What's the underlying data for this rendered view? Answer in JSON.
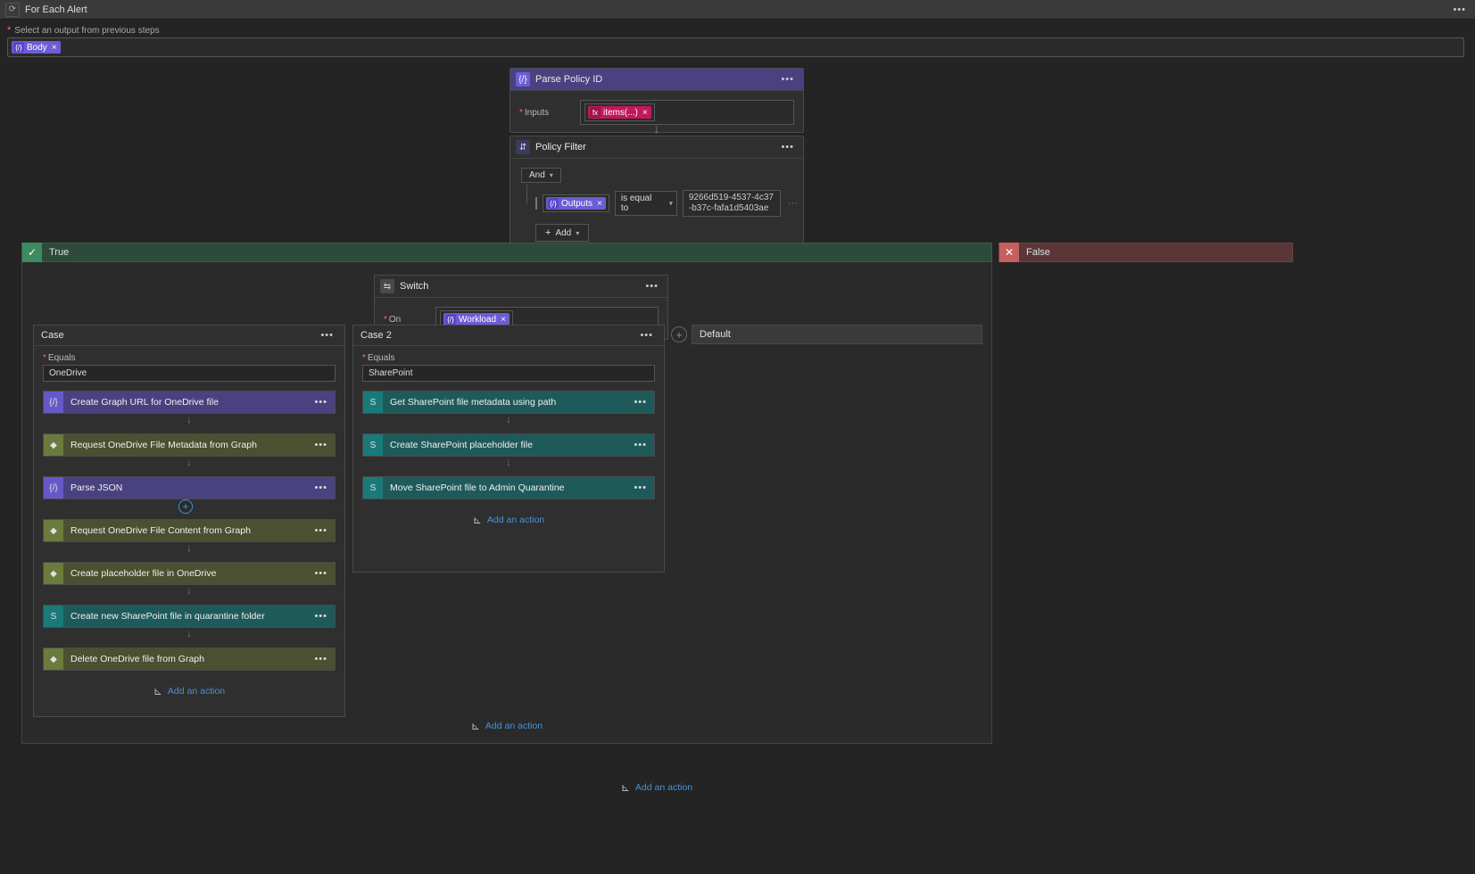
{
  "topbar": {
    "title": "For Each Alert"
  },
  "output_hint": "Select an output from previous steps",
  "body_token": "Body",
  "parse_policy": {
    "title": "Parse Policy ID",
    "inputs_label": "Inputs",
    "token": "items(...)"
  },
  "policy_filter": {
    "title": "Policy Filter",
    "and": "And",
    "output_token": "Outputs",
    "op": "is equal to",
    "value": "9266d519-4537-4c37-b37c-fafa1d5403ae",
    "add": "Add"
  },
  "branches": {
    "true": "True",
    "false": "False"
  },
  "switch": {
    "title": "Switch",
    "on_label": "On",
    "workload_token": "Workload"
  },
  "case1": {
    "title": "Case",
    "equals_label": "Equals",
    "equals_value": "OneDrive",
    "actions": [
      {
        "title": "Create Graph URL for OneDrive file",
        "style": "purp"
      },
      {
        "title": "Request OneDrive File Metadata from Graph",
        "style": "olive"
      },
      {
        "title": "Parse JSON",
        "style": "purp"
      },
      {
        "title": "Request OneDrive File Content from Graph",
        "style": "olive"
      },
      {
        "title": "Create placeholder file in OneDrive",
        "style": "olive"
      },
      {
        "title": "Create new SharePoint file in quarantine folder",
        "style": "teal"
      },
      {
        "title": "Delete OneDrive file from Graph",
        "style": "olive"
      }
    ]
  },
  "case2": {
    "title": "Case 2",
    "equals_label": "Equals",
    "equals_value": "SharePoint",
    "actions": [
      {
        "title": "Get SharePoint file metadata using path",
        "style": "teal"
      },
      {
        "title": "Create SharePoint placeholder file",
        "style": "teal"
      },
      {
        "title": "Move SharePoint file to Admin Quarantine",
        "style": "teal"
      }
    ]
  },
  "default_label": "Default",
  "add_action": "Add an action"
}
